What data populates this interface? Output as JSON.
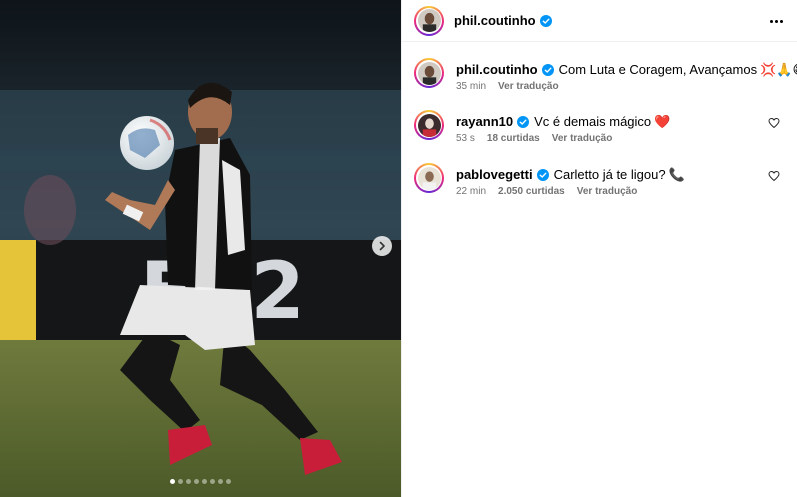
{
  "post": {
    "carousel": {
      "total": 8,
      "active": 0
    }
  },
  "header": {
    "username": "phil.coutinho",
    "more_icon": "more-horizontal-icon"
  },
  "caption": {
    "username": "phil.coutinho",
    "text": "Com Luta e Coragem, Avançamos",
    "emojis": "💢🙏😁",
    "time": "35 min",
    "translate": "Ver tradução"
  },
  "comments": [
    {
      "username": "rayann10",
      "text": "Vc é demais mágico",
      "emoji": "❤️",
      "time": "53 s",
      "likes": "18 curtidas",
      "translate": "Ver tradução"
    },
    {
      "username": "pablovegetti",
      "text": "Carletto já te ligou?",
      "emoji": "📞",
      "time": "22 min",
      "likes": "2.050 curtidas",
      "translate": "Ver tradução"
    }
  ],
  "colors": {
    "verified": "#0095f6",
    "meta_text": "#737373",
    "divider": "#efefef"
  }
}
